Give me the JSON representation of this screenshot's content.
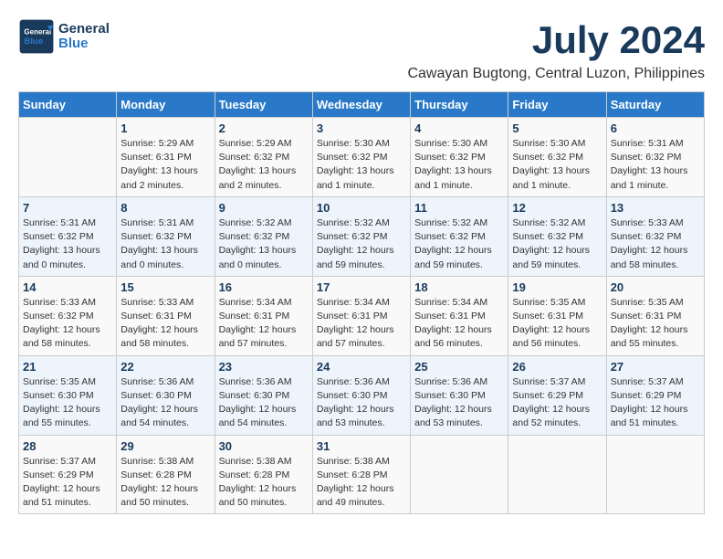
{
  "header": {
    "logo_general": "General",
    "logo_blue": "Blue",
    "month_title": "July 2024",
    "location": "Cawayan Bugtong, Central Luzon, Philippines"
  },
  "weekdays": [
    "Sunday",
    "Monday",
    "Tuesday",
    "Wednesday",
    "Thursday",
    "Friday",
    "Saturday"
  ],
  "weeks": [
    [
      {
        "day": "",
        "sunrise": "",
        "sunset": "",
        "daylight": ""
      },
      {
        "day": "1",
        "sunrise": "Sunrise: 5:29 AM",
        "sunset": "Sunset: 6:31 PM",
        "daylight": "Daylight: 13 hours and 2 minutes."
      },
      {
        "day": "2",
        "sunrise": "Sunrise: 5:29 AM",
        "sunset": "Sunset: 6:32 PM",
        "daylight": "Daylight: 13 hours and 2 minutes."
      },
      {
        "day": "3",
        "sunrise": "Sunrise: 5:30 AM",
        "sunset": "Sunset: 6:32 PM",
        "daylight": "Daylight: 13 hours and 1 minute."
      },
      {
        "day": "4",
        "sunrise": "Sunrise: 5:30 AM",
        "sunset": "Sunset: 6:32 PM",
        "daylight": "Daylight: 13 hours and 1 minute."
      },
      {
        "day": "5",
        "sunrise": "Sunrise: 5:30 AM",
        "sunset": "Sunset: 6:32 PM",
        "daylight": "Daylight: 13 hours and 1 minute."
      },
      {
        "day": "6",
        "sunrise": "Sunrise: 5:31 AM",
        "sunset": "Sunset: 6:32 PM",
        "daylight": "Daylight: 13 hours and 1 minute."
      }
    ],
    [
      {
        "day": "7",
        "sunrise": "Sunrise: 5:31 AM",
        "sunset": "Sunset: 6:32 PM",
        "daylight": "Daylight: 13 hours and 0 minutes."
      },
      {
        "day": "8",
        "sunrise": "Sunrise: 5:31 AM",
        "sunset": "Sunset: 6:32 PM",
        "daylight": "Daylight: 13 hours and 0 minutes."
      },
      {
        "day": "9",
        "sunrise": "Sunrise: 5:32 AM",
        "sunset": "Sunset: 6:32 PM",
        "daylight": "Daylight: 13 hours and 0 minutes."
      },
      {
        "day": "10",
        "sunrise": "Sunrise: 5:32 AM",
        "sunset": "Sunset: 6:32 PM",
        "daylight": "Daylight: 12 hours and 59 minutes."
      },
      {
        "day": "11",
        "sunrise": "Sunrise: 5:32 AM",
        "sunset": "Sunset: 6:32 PM",
        "daylight": "Daylight: 12 hours and 59 minutes."
      },
      {
        "day": "12",
        "sunrise": "Sunrise: 5:32 AM",
        "sunset": "Sunset: 6:32 PM",
        "daylight": "Daylight: 12 hours and 59 minutes."
      },
      {
        "day": "13",
        "sunrise": "Sunrise: 5:33 AM",
        "sunset": "Sunset: 6:32 PM",
        "daylight": "Daylight: 12 hours and 58 minutes."
      }
    ],
    [
      {
        "day": "14",
        "sunrise": "Sunrise: 5:33 AM",
        "sunset": "Sunset: 6:32 PM",
        "daylight": "Daylight: 12 hours and 58 minutes."
      },
      {
        "day": "15",
        "sunrise": "Sunrise: 5:33 AM",
        "sunset": "Sunset: 6:31 PM",
        "daylight": "Daylight: 12 hours and 58 minutes."
      },
      {
        "day": "16",
        "sunrise": "Sunrise: 5:34 AM",
        "sunset": "Sunset: 6:31 PM",
        "daylight": "Daylight: 12 hours and 57 minutes."
      },
      {
        "day": "17",
        "sunrise": "Sunrise: 5:34 AM",
        "sunset": "Sunset: 6:31 PM",
        "daylight": "Daylight: 12 hours and 57 minutes."
      },
      {
        "day": "18",
        "sunrise": "Sunrise: 5:34 AM",
        "sunset": "Sunset: 6:31 PM",
        "daylight": "Daylight: 12 hours and 56 minutes."
      },
      {
        "day": "19",
        "sunrise": "Sunrise: 5:35 AM",
        "sunset": "Sunset: 6:31 PM",
        "daylight": "Daylight: 12 hours and 56 minutes."
      },
      {
        "day": "20",
        "sunrise": "Sunrise: 5:35 AM",
        "sunset": "Sunset: 6:31 PM",
        "daylight": "Daylight: 12 hours and 55 minutes."
      }
    ],
    [
      {
        "day": "21",
        "sunrise": "Sunrise: 5:35 AM",
        "sunset": "Sunset: 6:30 PM",
        "daylight": "Daylight: 12 hours and 55 minutes."
      },
      {
        "day": "22",
        "sunrise": "Sunrise: 5:36 AM",
        "sunset": "Sunset: 6:30 PM",
        "daylight": "Daylight: 12 hours and 54 minutes."
      },
      {
        "day": "23",
        "sunrise": "Sunrise: 5:36 AM",
        "sunset": "Sunset: 6:30 PM",
        "daylight": "Daylight: 12 hours and 54 minutes."
      },
      {
        "day": "24",
        "sunrise": "Sunrise: 5:36 AM",
        "sunset": "Sunset: 6:30 PM",
        "daylight": "Daylight: 12 hours and 53 minutes."
      },
      {
        "day": "25",
        "sunrise": "Sunrise: 5:36 AM",
        "sunset": "Sunset: 6:30 PM",
        "daylight": "Daylight: 12 hours and 53 minutes."
      },
      {
        "day": "26",
        "sunrise": "Sunrise: 5:37 AM",
        "sunset": "Sunset: 6:29 PM",
        "daylight": "Daylight: 12 hours and 52 minutes."
      },
      {
        "day": "27",
        "sunrise": "Sunrise: 5:37 AM",
        "sunset": "Sunset: 6:29 PM",
        "daylight": "Daylight: 12 hours and 51 minutes."
      }
    ],
    [
      {
        "day": "28",
        "sunrise": "Sunrise: 5:37 AM",
        "sunset": "Sunset: 6:29 PM",
        "daylight": "Daylight: 12 hours and 51 minutes."
      },
      {
        "day": "29",
        "sunrise": "Sunrise: 5:38 AM",
        "sunset": "Sunset: 6:28 PM",
        "daylight": "Daylight: 12 hours and 50 minutes."
      },
      {
        "day": "30",
        "sunrise": "Sunrise: 5:38 AM",
        "sunset": "Sunset: 6:28 PM",
        "daylight": "Daylight: 12 hours and 50 minutes."
      },
      {
        "day": "31",
        "sunrise": "Sunrise: 5:38 AM",
        "sunset": "Sunset: 6:28 PM",
        "daylight": "Daylight: 12 hours and 49 minutes."
      },
      {
        "day": "",
        "sunrise": "",
        "sunset": "",
        "daylight": ""
      },
      {
        "day": "",
        "sunrise": "",
        "sunset": "",
        "daylight": ""
      },
      {
        "day": "",
        "sunrise": "",
        "sunset": "",
        "daylight": ""
      }
    ]
  ]
}
